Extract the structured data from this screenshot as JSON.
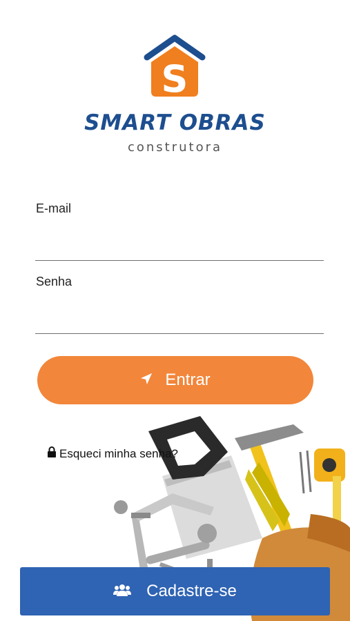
{
  "brand": {
    "name": "SMART OBRAS",
    "subtitle": "construtora",
    "logo_letter": "S"
  },
  "colors": {
    "brand_blue": "#1d4e8f",
    "brand_orange": "#f07f1f",
    "login_button": "#f2863a",
    "register_button": "#2f63b3"
  },
  "form": {
    "email_label": "E-mail",
    "email_value": "",
    "password_label": "Senha",
    "password_value": ""
  },
  "actions": {
    "login_label": "Entrar",
    "login_icon": "send-icon",
    "forgot_label": "Esqueci minha senha?",
    "forgot_icon": "lock-icon",
    "register_label": "Cadastre-se",
    "register_icon": "users-icon"
  },
  "background_image": "tools-illustration"
}
